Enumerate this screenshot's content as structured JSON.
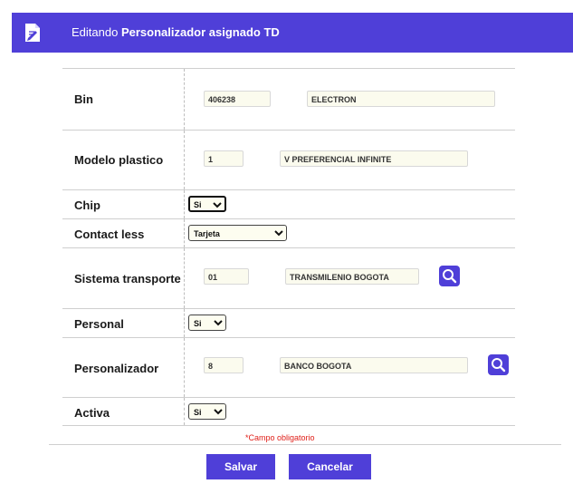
{
  "header": {
    "prefix": "Editando",
    "title": "Personalizador asignado TD",
    "icon": "edit-document-icon"
  },
  "form": {
    "bin": {
      "label": "Bin",
      "code": "406238",
      "name": "ELECTRON"
    },
    "modelo": {
      "label": "Modelo plastico",
      "code": "1",
      "name": "V PREFERENCIAL INFINITE"
    },
    "chip": {
      "label": "Chip",
      "value": "Si"
    },
    "contactless": {
      "label": "Contact less",
      "value": "Tarjeta"
    },
    "sistema": {
      "label": "Sistema transporte",
      "code": "01",
      "name": "TRANSMILENIO BOGOTA"
    },
    "personal": {
      "label": "Personal",
      "value": "Si"
    },
    "personalizador": {
      "label": "Personalizador",
      "code": "8",
      "name": "BANCO BOGOTA"
    },
    "activa": {
      "label": "Activa",
      "value": "Si"
    }
  },
  "required_note": "*Campo obligatorio",
  "buttons": {
    "save": "Salvar",
    "cancel": "Cancelar"
  },
  "colors": {
    "accent": "#4f3fd8",
    "required": "#e0201a"
  }
}
